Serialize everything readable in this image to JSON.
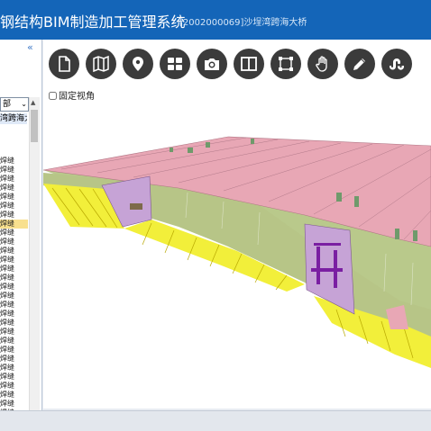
{
  "header": {
    "title": "钢结构BIM制造加工管理系统",
    "project": "[2002000069]沙埕湾跨海大桥"
  },
  "sidebar": {
    "collapse_label": "«",
    "dropdown_value": "部",
    "project_node": "湾跨海大",
    "items": [
      "焊缝",
      "焊缝",
      "焊缝",
      "焊缝",
      "焊缝",
      "焊缝",
      "焊缝",
      "焊缝",
      "焊缝",
      "焊缝",
      "焊缝",
      "焊缝",
      "焊缝",
      "焊缝",
      "焊缝",
      "焊缝",
      "焊缝",
      "焊缝",
      "焊缝",
      "焊缝",
      "焊缝",
      "焊缝",
      "焊缝",
      "焊缝",
      "焊缝",
      "焊缝",
      "焊缝",
      "焊缝",
      "焊缝",
      "焊缝"
    ],
    "selected_index": 7
  },
  "toolbar": {
    "icons": [
      "file-icon",
      "map-icon",
      "location-pin-icon",
      "grid-icon",
      "camera-icon",
      "split-view-icon",
      "frame-select-icon",
      "hand-pan-icon",
      "pencil-icon",
      "stumbleupon-icon"
    ]
  },
  "viewport": {
    "lock_view_label": "固定视角"
  },
  "colors": {
    "header": "#1465b8",
    "deck": "#e8a7b5",
    "ribs": "#f2ef3a",
    "web": "#b9c98b",
    "diaphragm": "#c6a3d6"
  }
}
